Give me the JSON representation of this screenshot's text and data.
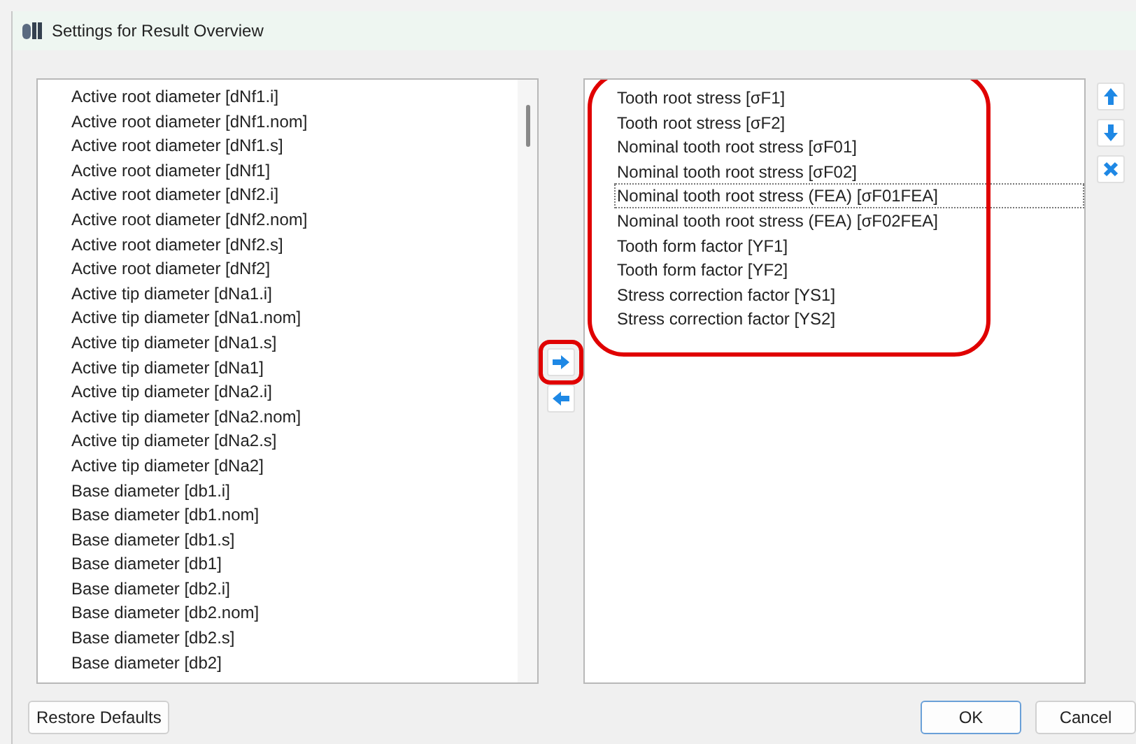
{
  "window": {
    "title": "Settings for Result Overview"
  },
  "available": {
    "items": [
      {
        "label": "Active root diameter [dNf1.i]"
      },
      {
        "label": "Active root diameter [dNf1.nom]"
      },
      {
        "label": "Active root diameter [dNf1.s]"
      },
      {
        "label": "Active root diameter [dNf1]"
      },
      {
        "label": "Active root diameter [dNf2.i]"
      },
      {
        "label": "Active root diameter [dNf2.nom]"
      },
      {
        "label": "Active root diameter [dNf2.s]"
      },
      {
        "label": "Active root diameter [dNf2]"
      },
      {
        "label": "Active tip diameter [dNa1.i]"
      },
      {
        "label": "Active tip diameter [dNa1.nom]"
      },
      {
        "label": "Active tip diameter [dNa1.s]"
      },
      {
        "label": "Active tip diameter [dNa1]"
      },
      {
        "label": "Active tip diameter [dNa2.i]"
      },
      {
        "label": "Active tip diameter [dNa2.nom]"
      },
      {
        "label": "Active tip diameter [dNa2.s]"
      },
      {
        "label": "Active tip diameter [dNa2]"
      },
      {
        "label": "Base diameter [db1.i]"
      },
      {
        "label": "Base diameter [db1.nom]"
      },
      {
        "label": "Base diameter [db1.s]"
      },
      {
        "label": "Base diameter [db1]"
      },
      {
        "label": "Base diameter [db2.i]"
      },
      {
        "label": "Base diameter [db2.nom]"
      },
      {
        "label": "Base diameter [db2.s]"
      },
      {
        "label": "Base diameter [db2]"
      }
    ]
  },
  "transfer_buttons": [
    {
      "kind": "add",
      "highlighted": true
    },
    {
      "kind": "remove",
      "highlighted": false
    }
  ],
  "chosen": {
    "highlighted": true,
    "items": [
      {
        "label": "Tooth root stress [σF1]",
        "selected": false
      },
      {
        "label": "Tooth root stress [σF2]",
        "selected": false
      },
      {
        "label": "Nominal tooth root stress [σF01]",
        "selected": false
      },
      {
        "label": "Nominal tooth root stress [σF02]",
        "selected": false
      },
      {
        "label": "Nominal tooth root stress (FEA) [σF01FEA]",
        "selected": true
      },
      {
        "label": "Nominal tooth root stress (FEA) [σF02FEA]",
        "selected": false
      },
      {
        "label": "Tooth form factor [YF1]",
        "selected": false
      },
      {
        "label": "Tooth form factor [YF2]",
        "selected": false
      },
      {
        "label": "Stress correction factor [YS1]",
        "selected": false
      },
      {
        "label": "Stress correction factor [YS2]",
        "selected": false
      }
    ]
  },
  "order_buttons": [
    {
      "kind": "up"
    },
    {
      "kind": "down"
    },
    {
      "kind": "delete"
    }
  ],
  "footer": {
    "restore": "Restore Defaults",
    "ok": "OK",
    "cancel": "Cancel"
  }
}
